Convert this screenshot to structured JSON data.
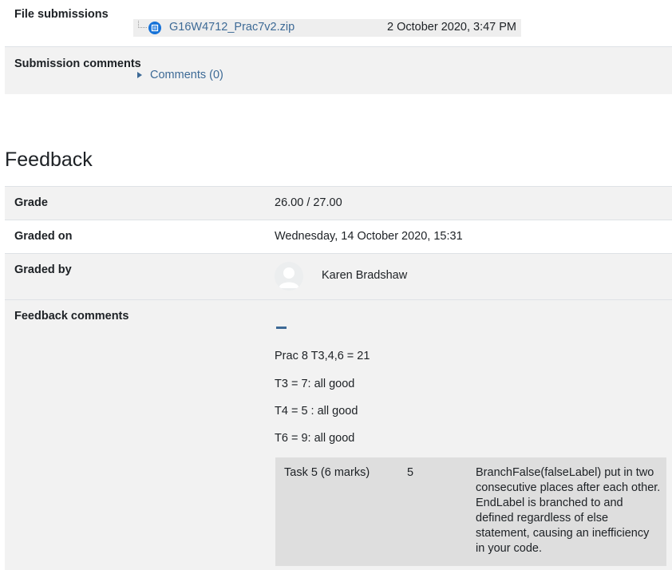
{
  "submission": {
    "file_label": "File submissions",
    "file_name": "G16W4712_Prac7v2.zip",
    "file_date": "2 October 2020, 3:47 PM",
    "comments_label": "Submission comments",
    "comments_link": "Comments (0)"
  },
  "feedback": {
    "title": "Feedback",
    "grade_label": "Grade",
    "grade_value": "26.00 / 27.00",
    "graded_on_label": "Graded on",
    "graded_on_value": "Wednesday, 14 October 2020, 15:31",
    "graded_by_label": "Graded by",
    "grader_name": "Karen Bradshaw",
    "comments_label": "Feedback comments",
    "comment_lines": [
      "Prac 8 T3,4,6 = 21",
      "T3 = 7:  all good",
      "T4 = 5 :  all good",
      "T6 = 9:  all good"
    ],
    "task_row": {
      "task": "Task 5 (6 marks)",
      "mark": "5",
      "comment": "BranchFalse(falseLabel) put in two consecutive places after each other. EndLabel is branched to and defined regardless of else statement, causing an inefficiency in your code."
    }
  },
  "colors": {
    "link": "#3d6a96",
    "file_icon": "#1672d8",
    "row_shade": "#f2f2f2",
    "task_box": "#dedede"
  },
  "icons": [
    "file-icon",
    "caret-right-icon",
    "collapse-icon",
    "avatar-icon"
  ]
}
